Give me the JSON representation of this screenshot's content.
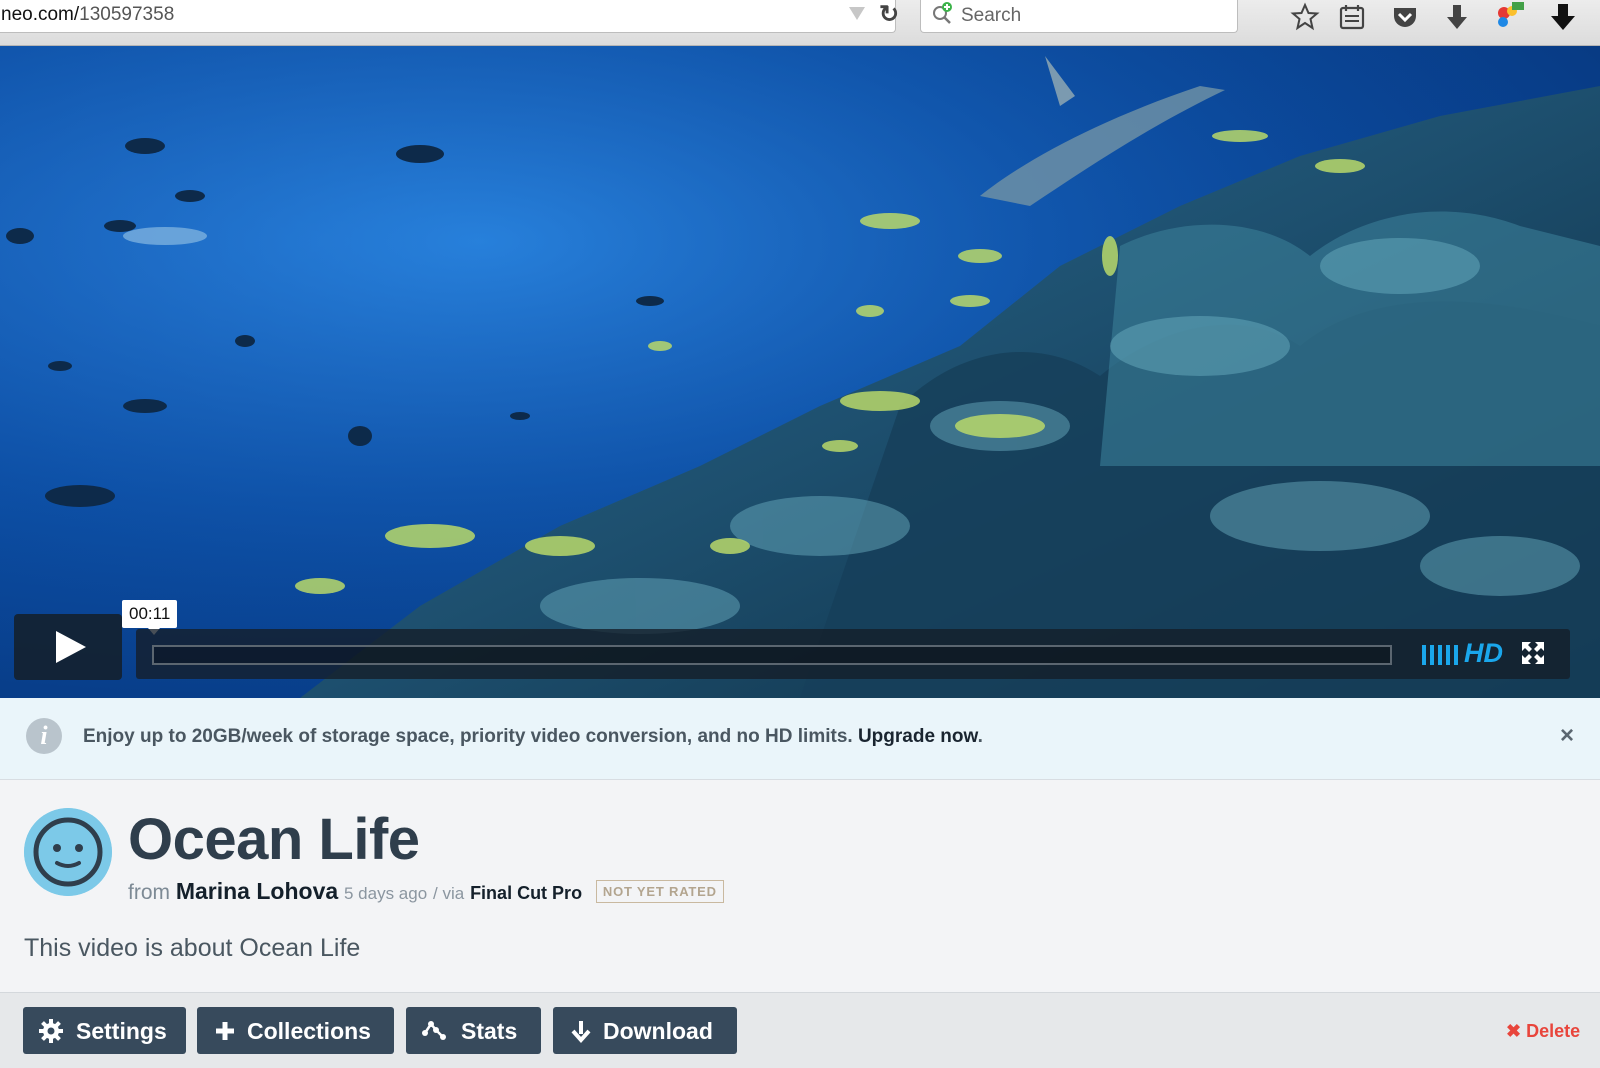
{
  "browser": {
    "url_host": "neo.com/",
    "url_path": "130597358",
    "search_placeholder": "Search",
    "icons": [
      "bookmark-star-icon",
      "reading-list-icon",
      "pocket-icon",
      "downloads-icon",
      "extension-icon",
      "download-arrow-icon"
    ]
  },
  "player": {
    "timecode": "00:11",
    "hd_label": "HD",
    "progress": 0.0
  },
  "banner": {
    "message": "Enjoy up to 20GB/week of storage space, priority video conversion, and no HD limits.",
    "link": "Upgrade now",
    "link_suffix": ".",
    "close_glyph": "×"
  },
  "video": {
    "title": "Ocean Life",
    "from_label": "from",
    "author": "Marina Lohova",
    "ago": "5 days ago",
    "via_label": "/ via",
    "app": "Final Cut Pro",
    "rating": "NOT YET RATED",
    "description": "This video is about Ocean Life"
  },
  "actions": {
    "settings": "Settings",
    "collections": "Collections",
    "stats": "Stats",
    "download": "Download",
    "delete": "Delete",
    "delete_glyph": "✖"
  },
  "colors": {
    "accent": "#1aa7ec",
    "button_bg": "#374a5c",
    "delete": "#e8453c",
    "banner_bg": "#eaf5fa"
  }
}
